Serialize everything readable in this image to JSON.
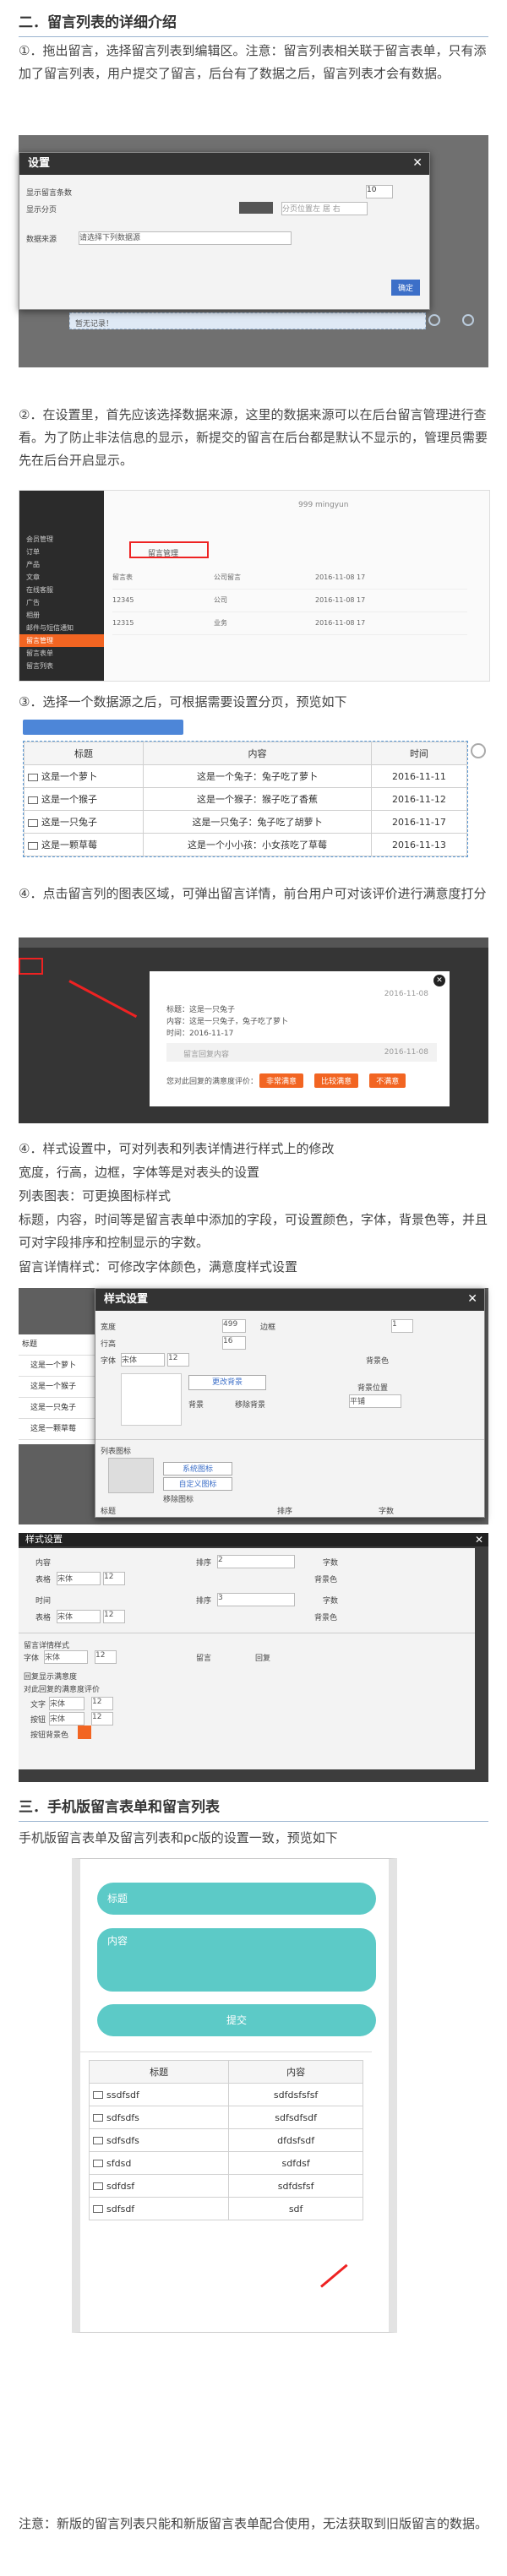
{
  "sec2_title": "二．留言列表的详细介绍",
  "p1": "①．拖出留言，选择留言列表到编辑区。注意：留言列表相关联于留言表单，只有添加了留言列表，用户提交了留言，后台有了数据之后，留言列表才会有数据。",
  "settings_dialog": {
    "title": "设置",
    "row1_label": "显示留言条数",
    "row1_value": "10",
    "row2_label": "显示分页",
    "row2_hint": "分页位置左 居 右",
    "row3_label": "数据来源",
    "row3_value": "请选择下列数据源",
    "ok": "确定",
    "behind": "暂无记录！"
  },
  "p2": "②．在设置里，首先应该选择数据来源，这里的数据来源可以在后台留言管理进行查看。为了防止非法信息的显示，新提交的留言在后台都是默认不显示的，管理员需要先在后台开启显示。",
  "admin": {
    "sidebar": [
      "会员管理",
      "订单",
      "产品",
      "文章",
      "在线客服",
      "广告",
      "相册",
      "邮件与短信通知",
      "留言管理",
      "留言表单",
      "留言列表"
    ],
    "active": "留言管理",
    "top": "999 mingyun",
    "tab": "留言管理",
    "rows": [
      [
        "留言表",
        "公司留言",
        "2016-11-08 17"
      ],
      [
        "12345",
        "公司",
        "2016-11-08 17"
      ],
      [
        "12315",
        "业务",
        "2016-11-08 17"
      ]
    ]
  },
  "p3": "③．选择一个数据源之后，可根据需要设置分页，预览如下",
  "list_preview": {
    "headers": [
      "标题",
      "内容",
      "时间"
    ],
    "rows": [
      [
        "这是一个萝卜",
        "这是一个兔子：兔子吃了萝卜",
        "2016-11-11"
      ],
      [
        "这是一个猴子",
        "这是一个猴子：猴子吃了香蕉",
        "2016-11-12"
      ],
      [
        "这是一只兔子",
        "这是一只兔子：兔子吃了胡萝卜",
        "2016-11-17"
      ],
      [
        "这是一颗草莓",
        "这是一个小小孩：小女孩吃了草莓",
        "2016-11-13"
      ]
    ]
  },
  "p4": "④．点击留言列的图表区域，可弹出留言详情，前台用户可对该评价进行满意度打分",
  "detail_popup": {
    "date": "2016-11-08",
    "line1": "标题：这是一只兔子",
    "line2": "内容：这是一只兔子，兔子吃了萝卜",
    "line3": "时间：2016-11-17",
    "reply": "留言回复内容",
    "reply_date": "2016-11-08",
    "question": "您对此回复的满意度评价：",
    "b1": "非常满意",
    "b2": "比较满意",
    "b3": "不满意"
  },
  "p5a": "④．样式设置中，可对列表和列表详情进行样式上的修改",
  "p5b": "宽度，行高，边框，字体等是对表头的设置",
  "p5c": "列表图表：可更换图标样式",
  "p5d": "标题，内容，时间等是留言表单中添加的字段，可设置颜色，字体，背景色等，并且可对字段排序和控制显示的字数。",
  "p5e": "留言详情样式：可修改字体颜色，满意度样式设置",
  "style1": {
    "title": "样式设置",
    "width": "宽度",
    "width_v": "499",
    "border": "边框",
    "border_v": "1",
    "lh": "行高",
    "lh_v": "16",
    "font": "字体",
    "font_v": "宋体",
    "size_v": "12",
    "bg": "背景色",
    "change_bg": "更改背景",
    "bgimg": "背景",
    "clearbg": "移除背景",
    "bgpos": "背景位置",
    "tile": "平铺",
    "list_icon": "列表图标",
    "sys_icon": "系统图标",
    "custom_icon": "自定义图标",
    "remove_icon": "移除图标",
    "title_chk": "标题",
    "sort": "排序",
    "chars": "字数",
    "behind": [
      "标题",
      "这是一个萝卜",
      "这是一个猴子",
      "这是一只兔子",
      "这是一颗草莓"
    ]
  },
  "style2": {
    "title": "样式设置",
    "content": "内容",
    "time": "时间",
    "table": "表格",
    "font_v": "宋体",
    "size_v": "12",
    "sort": "排序",
    "sort1": "2",
    "sort2": "3",
    "chars": "字数",
    "bg": "背景色",
    "detail_style": "留言详情样式",
    "font": "字体",
    "msg": "留言",
    "reply": "回复",
    "sat": "回复显示满意度",
    "sat_chk": "对此回复的满意度评价",
    "txt": "文字",
    "btn": "按钮",
    "btnbg": "按钮背景色"
  },
  "sec3_title": "三．手机版留言表单和留言列表",
  "p6": "手机版留言表单及留言列表和pc版的设置一致，预览如下",
  "mobile": {
    "title_ph": "标题",
    "content_ph": "内容",
    "submit": "提交",
    "headers": [
      "标题",
      "内容"
    ],
    "rows": [
      [
        "ssdfsdf",
        "sdfdsfsfsf"
      ],
      [
        "sdfsdfs",
        "sdfsdfsdf"
      ],
      [
        "sdfsdfs",
        "dfdsfsdf"
      ],
      [
        "sfdsd",
        "sdfdsf"
      ],
      [
        "sdfdsf",
        "sdfdsfsf"
      ],
      [
        "sdfsdf",
        "sdf"
      ]
    ]
  },
  "note": "注意：新版的留言列表只能和新版留言表单配合使用，无法获取到旧版留言的数据。",
  "colors": {
    "accent": "#f26522",
    "teal": "#5ccac7",
    "blue": "#3c6fc8",
    "dark": "#333333"
  }
}
